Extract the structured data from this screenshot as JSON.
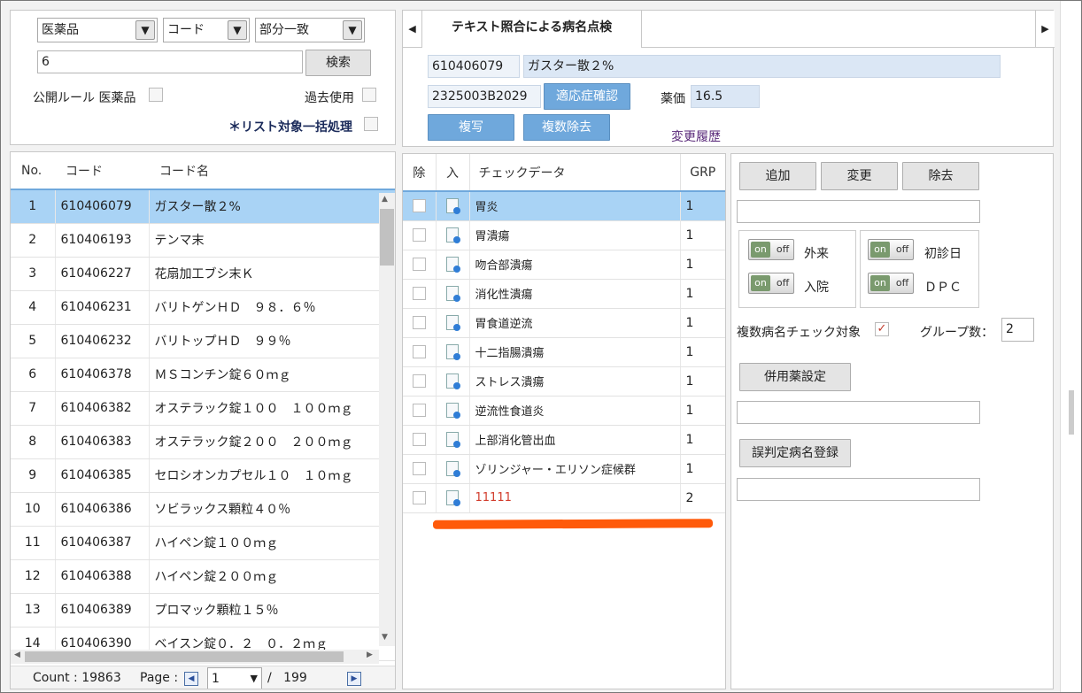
{
  "search": {
    "category": "医薬品",
    "field": "コード",
    "match": "部分一致",
    "query": "6",
    "search_label": "検索",
    "public_rule_label": "公開ルール 医薬品",
    "past_use_label": "過去使用",
    "bulk_label": "＊リスト対象一括処理"
  },
  "list": {
    "headers": [
      "No.",
      "コード",
      "コード名"
    ],
    "rows": [
      {
        "no": "1",
        "code": "610406079",
        "name": "ガスター散２%"
      },
      {
        "no": "2",
        "code": "610406193",
        "name": "テンマ末"
      },
      {
        "no": "3",
        "code": "610406227",
        "name": "花扇加工ブシ末Ｋ"
      },
      {
        "no": "4",
        "code": "610406231",
        "name": "バリトゲンＨＤ　９８．６％"
      },
      {
        "no": "5",
        "code": "610406232",
        "name": "バリトップＨＤ　９９％"
      },
      {
        "no": "6",
        "code": "610406378",
        "name": "ＭＳコンチン錠６０ｍｇ"
      },
      {
        "no": "7",
        "code": "610406382",
        "name": "オステラック錠１００　１００ｍｇ"
      },
      {
        "no": "8",
        "code": "610406383",
        "name": "オステラック錠２００　２００ｍｇ"
      },
      {
        "no": "9",
        "code": "610406385",
        "name": "セロシオンカプセル１０　１０ｍｇ"
      },
      {
        "no": "10",
        "code": "610406386",
        "name": "ソビラックス顆粒４０％"
      },
      {
        "no": "11",
        "code": "610406387",
        "name": "ハイペン錠１００ｍｇ"
      },
      {
        "no": "12",
        "code": "610406388",
        "name": "ハイペン錠２００ｍｇ"
      },
      {
        "no": "13",
        "code": "610406389",
        "name": "プロマック顆粒１５％"
      },
      {
        "no": "14",
        "code": "610406390",
        "name": "ベイスン錠０．２　０．２ｍｇ"
      }
    ],
    "count_label": "Count : 19863",
    "page_label": "Page :",
    "page_value": "1",
    "page_total": "/   199"
  },
  "detail": {
    "tab_label": "テキスト照合による病名点検",
    "code": "610406079",
    "name": "ガスター散２%",
    "sub_code": "2325003B2029",
    "indication_label": "適応症確認",
    "price_label": "薬価",
    "price_value": "16.5",
    "copy_label": "複写",
    "multi_remove_label": "複数除去",
    "history_label": "変更履歴"
  },
  "check": {
    "headers": [
      "除",
      "入",
      "チェックデータ",
      "GRP"
    ],
    "rows": [
      {
        "name": "胃炎",
        "grp": "1"
      },
      {
        "name": "胃潰瘍",
        "grp": "1"
      },
      {
        "name": "吻合部潰瘍",
        "grp": "1"
      },
      {
        "name": "消化性潰瘍",
        "grp": "1"
      },
      {
        "name": "胃食道逆流",
        "grp": "1"
      },
      {
        "name": "十二指腸潰瘍",
        "grp": "1"
      },
      {
        "name": "ストレス潰瘍",
        "grp": "1"
      },
      {
        "name": "逆流性食道炎",
        "grp": "1"
      },
      {
        "name": "上部消化管出血",
        "grp": "1"
      },
      {
        "name": "ゾリンジャー・エリソン症候群",
        "grp": "1"
      },
      {
        "name": "11111",
        "grp": "2"
      }
    ]
  },
  "actions": {
    "add_label": "追加",
    "change_label": "変更",
    "remove_label": "除去",
    "outpatient_label": "外来",
    "inpatient_label": "入院",
    "first_visit_label": "初診日",
    "dpc_label": "ＤＰＣ",
    "toggle_on": "on",
    "toggle_off": "off",
    "multi_check_label": "複数病名チェック対象",
    "group_count_label": "グループ数：",
    "group_count_value": "2",
    "combo_label": "併用薬設定",
    "misjudge_label": "誤判定病名登録"
  },
  "colors": {
    "accent": "#6fa8dc",
    "selection": "#a9d3f5",
    "highlight_underline": "#ff5a0a",
    "error_text": "#d23c2c"
  }
}
